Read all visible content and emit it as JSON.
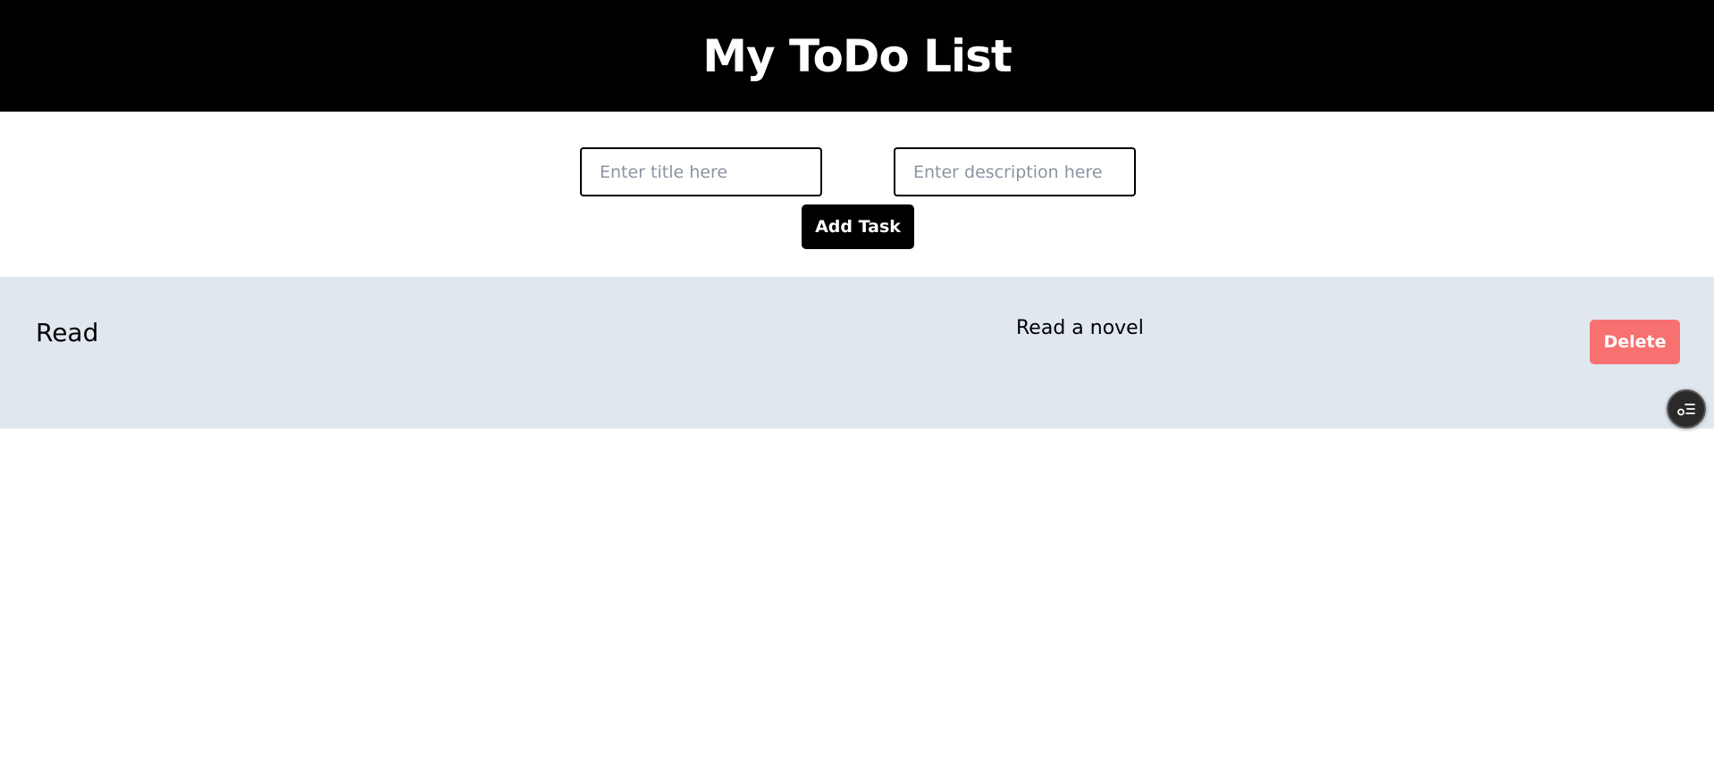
{
  "header": {
    "title": "My ToDo List"
  },
  "form": {
    "title_placeholder": "Enter title here",
    "description_placeholder": "Enter description here",
    "add_button_label": "Add Task"
  },
  "todos": [
    {
      "title": "Read",
      "description": "Read a novel",
      "delete_label": "Delete"
    }
  ],
  "floating_button": {
    "icon": "task-list-icon"
  },
  "colors": {
    "header_bg": "#000000",
    "row_bg": "#e0e7ef",
    "delete_bg": "#f87171"
  }
}
